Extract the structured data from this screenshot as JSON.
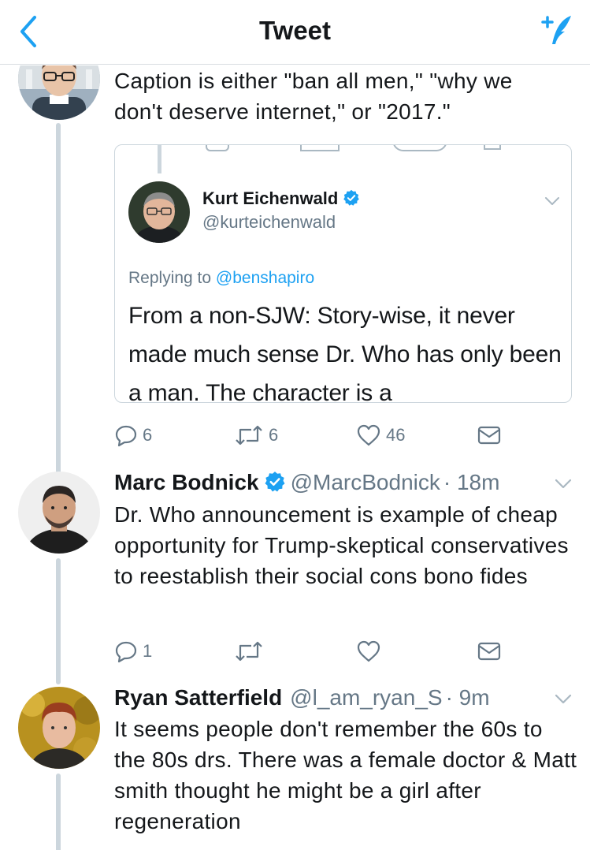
{
  "header": {
    "title": "Tweet"
  },
  "tweets": [
    {
      "text": "Caption is either \"ban all men,\" \"why we don't deserve internet,\" or \"2017.\"",
      "quoted": {
        "name": "Kurt Eichenwald",
        "handle": "@kurteichenwald",
        "replying_prefix": "Replying to ",
        "replying_to": "@benshapiro",
        "text": "From a non-SJW: Story-wise, it never made much sense Dr. Who has only been a man. The character is a"
      },
      "actions": {
        "replies": "6",
        "retweets": "6",
        "likes": "46"
      }
    },
    {
      "name": "Marc Bodnick",
      "handle": "@MarcBodnick",
      "time": "· 18m",
      "text": "Dr. Who announcement is example of cheap opportunity for Trump-skeptical conservatives to reestablish their social cons bono fides",
      "actions": {
        "replies": "1",
        "retweets": "",
        "likes": ""
      }
    },
    {
      "name": "Ryan Satterfield",
      "handle": "@l_am_ryan_S",
      "time": "· 9m",
      "text": "It seems people don't remember the 60s to the 80s drs. There was a female doctor & Matt smith thought he might be a girl after regeneration"
    }
  ],
  "colors": {
    "accent": "#1da1f2",
    "secondary_text": "#657786",
    "thread_line": "#ccd6dd",
    "divider": "#d8dde1"
  }
}
